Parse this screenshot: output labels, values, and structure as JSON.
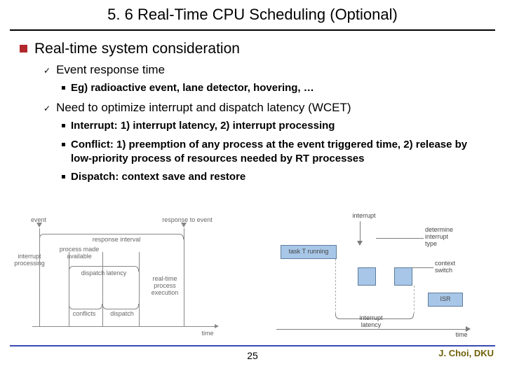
{
  "title": "5. 6 Real-Time CPU Scheduling (Optional)",
  "main_bullet": "Real-time system consideration",
  "sub": [
    {
      "label": "Event response time",
      "items": [
        "Eg) radioactive event, lane detector, hovering, …"
      ]
    },
    {
      "label": "Need to optimize interrupt and dispatch latency (WCET)",
      "items": [
        "Interrupt: 1) interrupt latency, 2) interrupt processing",
        "Conflict: 1) preemption of any process at the event triggered time, 2) release by low-priority process of resources needed by RT processes",
        "Dispatch: context save and restore"
      ]
    }
  ],
  "figL": {
    "event": "event",
    "response_to_event": "response to event",
    "response_interval": "response interval",
    "interrupt_processing": "interrupt\nprocessing",
    "process_made_available": "process made\navailable",
    "dispatch_latency": "dispatch latency",
    "real_time_process_execution": "real-time\nprocess\nexecution",
    "conflicts": "conflicts",
    "dispatch": "dispatch",
    "time": "time"
  },
  "figR": {
    "interrupt": "interrupt",
    "task_running": "task T running",
    "determine": "determine\ninterrupt\ntype",
    "context_switch": "context\nswitch",
    "isr": "ISR",
    "interrupt_latency": "interrupt\nlatency",
    "time": "time"
  },
  "page_number": "25",
  "credits": "J. Choi, DKU"
}
